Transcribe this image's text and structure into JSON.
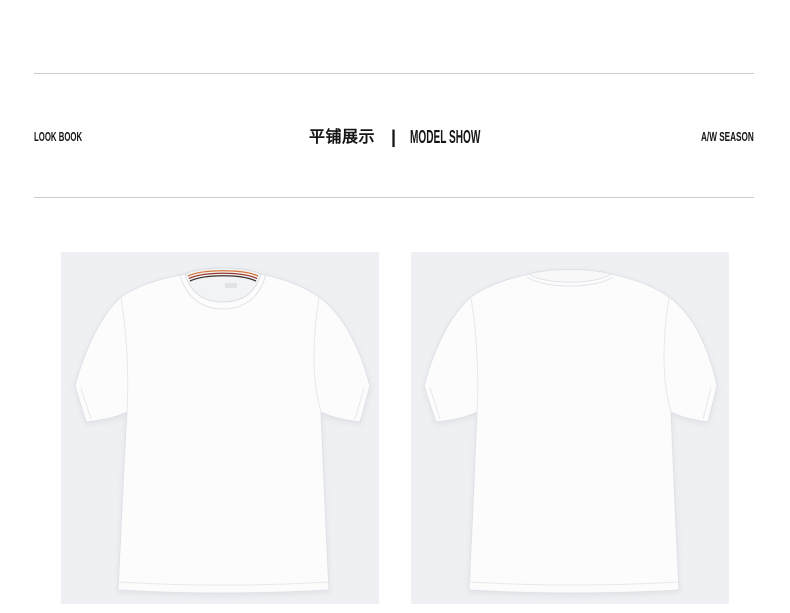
{
  "header": {
    "left_label": "LOOK BOOK",
    "title_cn": "平铺展示",
    "separator": "|",
    "title_en": "MODEL SHOW",
    "right_label": "A/W SEASON"
  },
  "colors": {
    "panel_background": "#eef0f3",
    "shirt": "#fcfcfd",
    "collar_stripe_orange": "#d9783c",
    "collar_stripe_red": "#9b3b2c",
    "collar_stripe_dark": "#3b3030"
  }
}
